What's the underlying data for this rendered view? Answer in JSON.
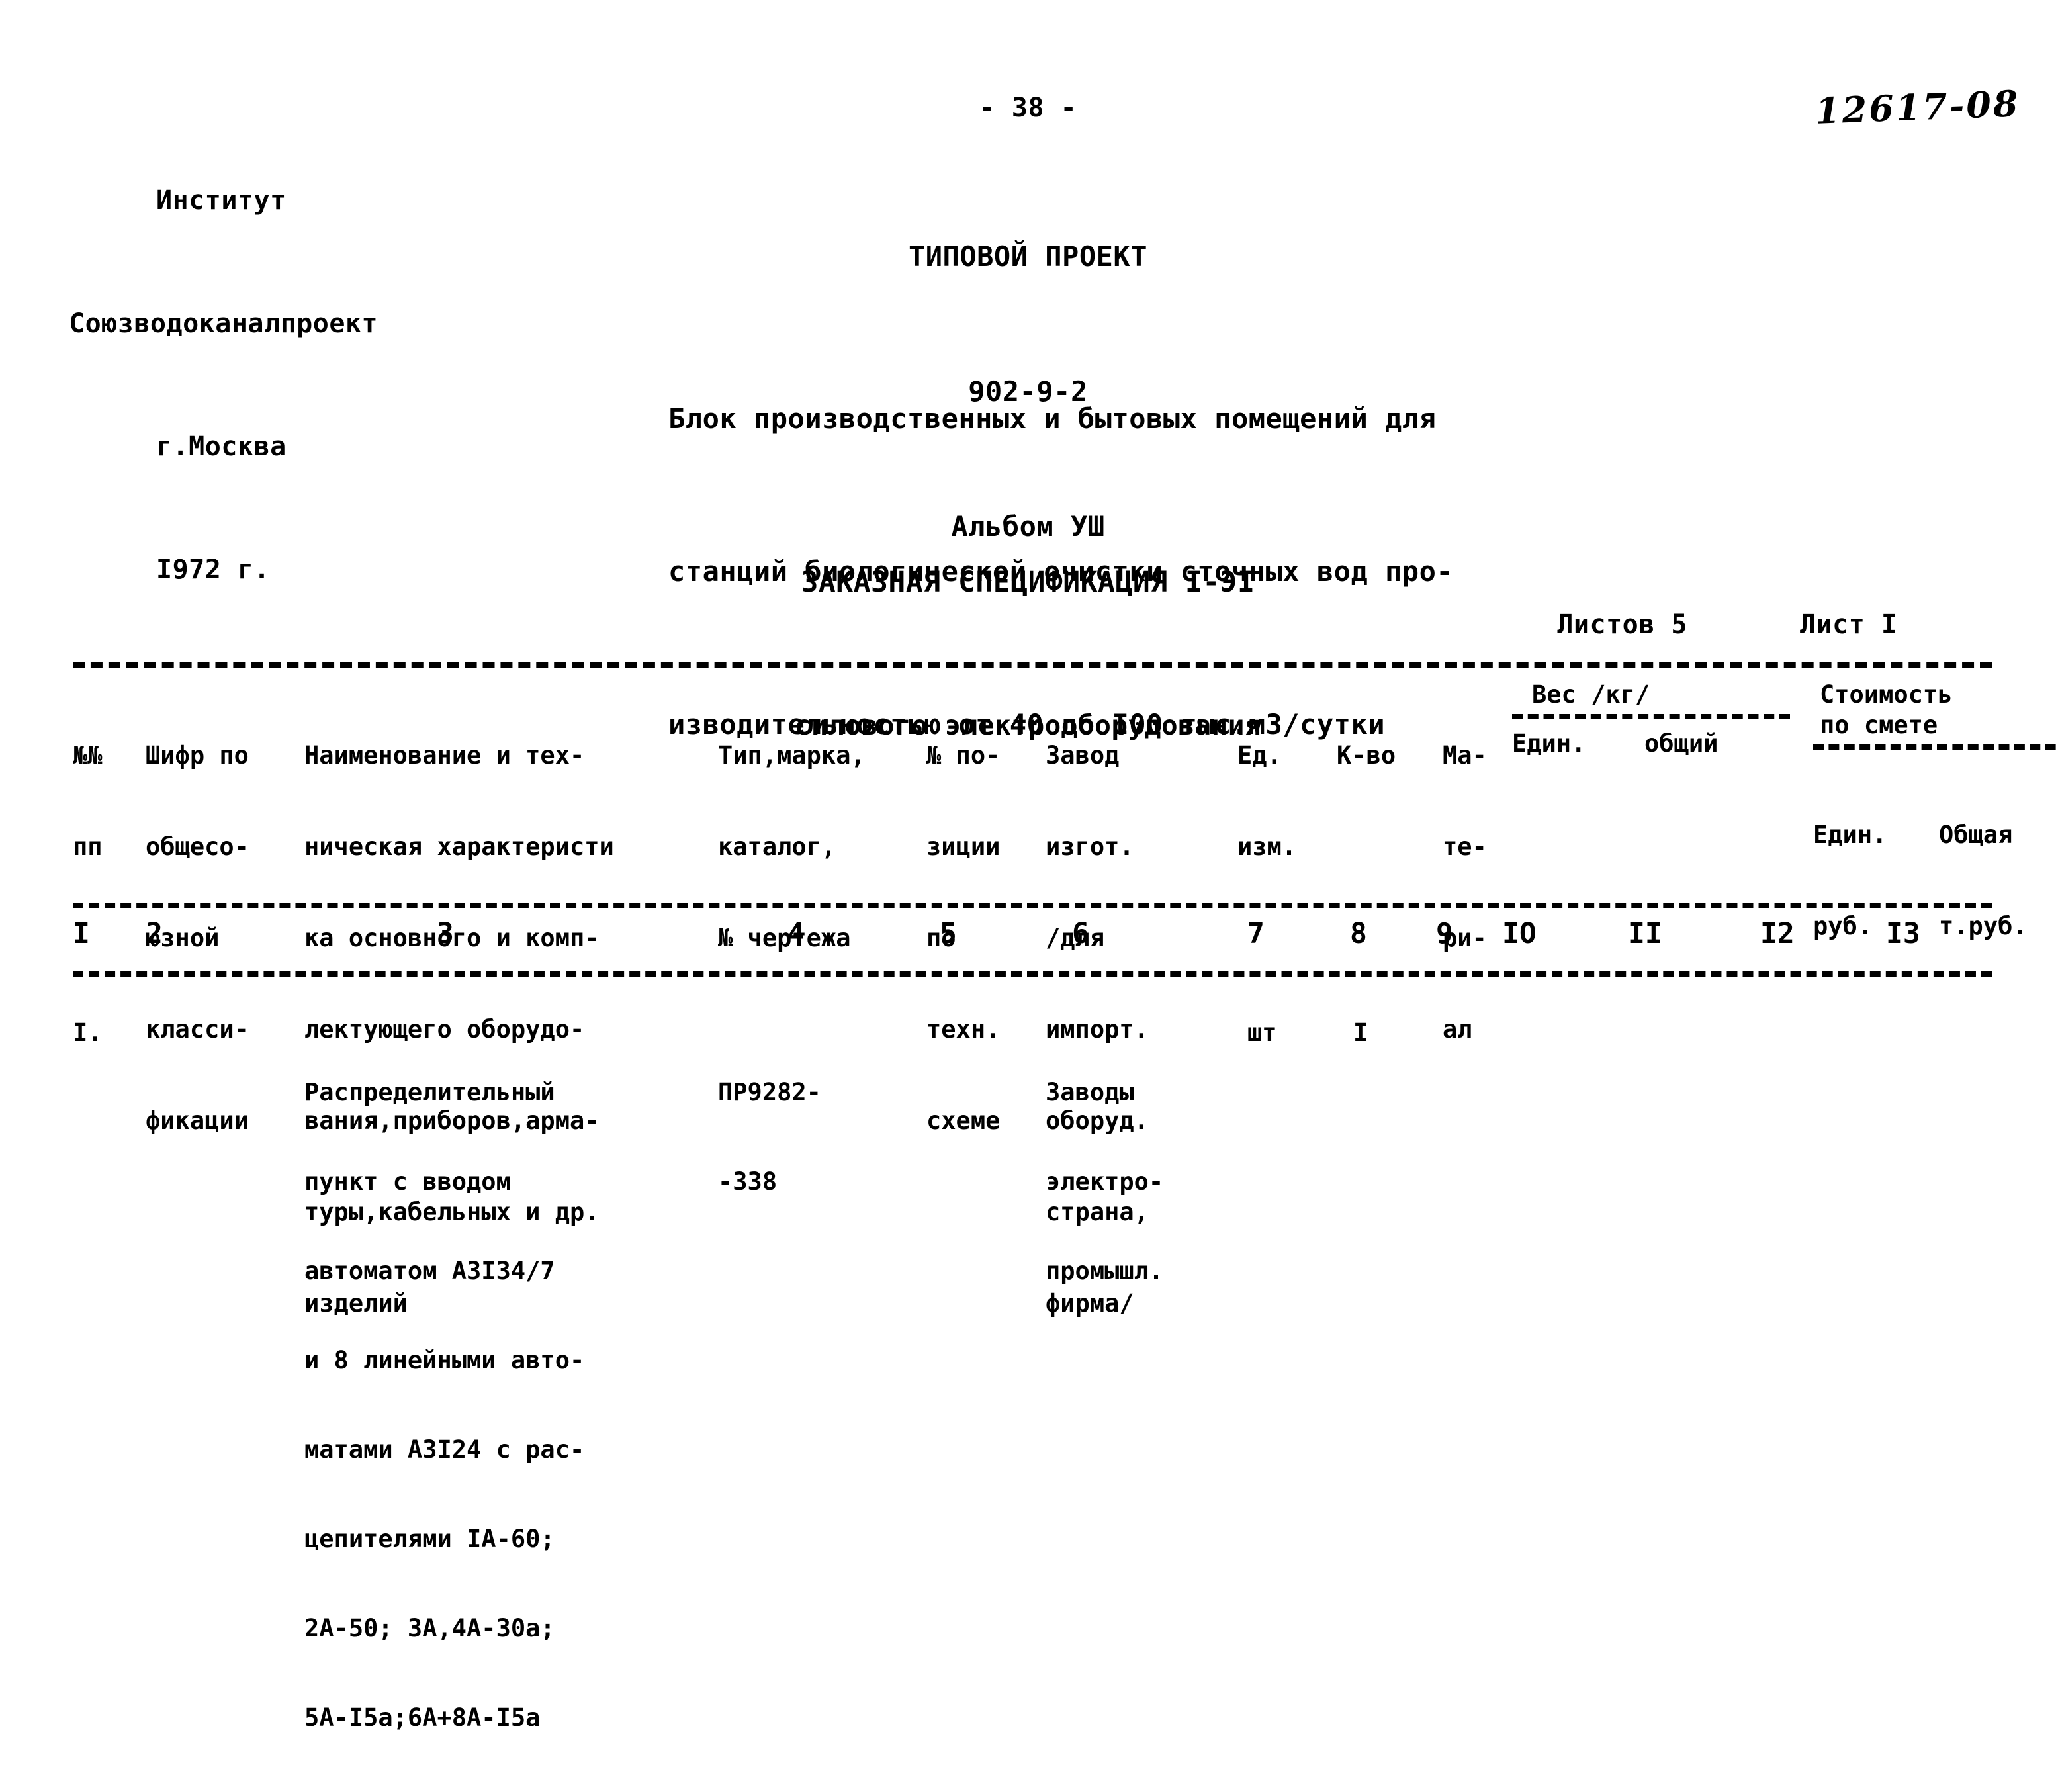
{
  "header": {
    "institute_lines": [
      "Институт",
      "Союзводоканалпроект",
      "г.Москва",
      "I972 г."
    ],
    "archive_number": "12617-08",
    "page_number": "- 38 -",
    "project_lines": [
      "ТИПОВОЙ ПРОЕКТ",
      "902-9-2",
      "Альбом УШ"
    ],
    "description_lines": [
      "Блок производственных и бытовых помещений для",
      "станций биологической очистки сточных вод про-",
      "изводительностью от 40 до I00 тыс.м3/сутки"
    ],
    "spec_title": "ЗАКАЗНАЯ СПЕЦИФИКАЦИЯ I-ЭI",
    "spec_subtitle": "силового электрооборудования",
    "sheets_total_label": "Листов 5",
    "sheet_current_label": "Лист I"
  },
  "table": {
    "columns": {
      "c1": [
        "№№",
        "пп"
      ],
      "c2": [
        "Шифр по",
        "общесо-",
        "юзной",
        "класси-",
        "фикации"
      ],
      "c3": [
        "Наименование и тех-",
        "ническая характеристи",
        "ка основного и комп-",
        "лектующего оборудо-",
        "вания,приборов,арма-",
        "туры,кабельных и др.",
        "изделий"
      ],
      "c4": [
        "Тип,марка,",
        "каталог,",
        "№ чертежа"
      ],
      "c5": [
        "№ по-",
        "зиции",
        "по",
        "техн.",
        "схеме"
      ],
      "c6": [
        "Завод",
        "изгот.",
        "/для",
        "импорт.",
        "оборуд.",
        "страна,",
        "фирма/"
      ],
      "c7": [
        "Ед.",
        "изм."
      ],
      "c8": [
        "К-во"
      ],
      "c9": [
        "Ма-",
        "те-",
        "ри-",
        "ал"
      ],
      "c10_group_title": "Вес /кг/",
      "c10_sub": "Един.",
      "c11_sub": "общий",
      "c12_group_title": "Стоимость",
      "c12_group_title2": "по смете",
      "c12_sub": [
        "Един.",
        "руб."
      ],
      "c13_sub": [
        "Общая",
        "т.руб."
      ]
    },
    "column_numbers": [
      "I",
      "2",
      "3",
      "4",
      "5",
      "6",
      "7",
      "8",
      "9",
      "IO",
      "II",
      "I2",
      "I3"
    ],
    "rows": [
      {
        "num": "I.",
        "code": "",
        "name_lines": [
          "Распределительный",
          "пункт с вводом",
          "автоматом АЗI34/7",
          "и 8 линейными авто-",
          "матами АЗI24 с рас-",
          "цепителями IА-60;",
          "2А-50; 3А,4А-30а;",
          "5А-I5а;6А+8А-I5а"
        ],
        "type_lines": [
          "ПР9282-",
          "-338"
        ],
        "position": "",
        "factory_lines": [
          "Заводы",
          "электро-",
          "промышл."
        ],
        "unit": "шт",
        "qty": "I",
        "material": "",
        "weight_unit": "",
        "weight_total": "",
        "cost_unit": "",
        "cost_total": ""
      }
    ]
  }
}
